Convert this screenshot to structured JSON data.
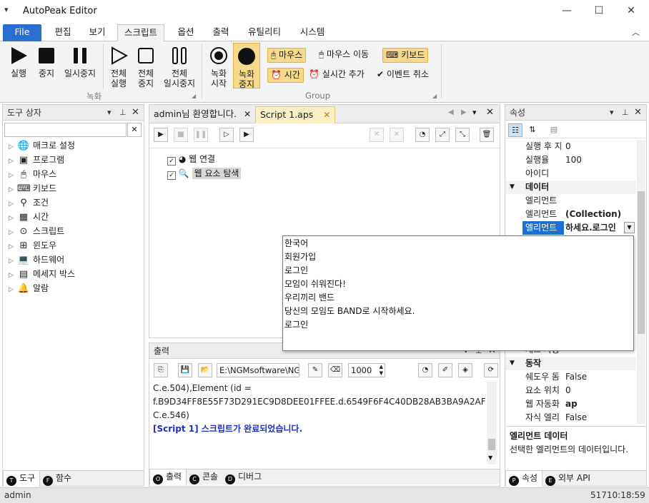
{
  "window": {
    "title": "AutoPeak Editor",
    "qa_icon": "quick-access-chevron",
    "controls": [
      "—",
      "☐",
      "✕"
    ]
  },
  "menu": {
    "file": "File",
    "tabs": [
      "편집",
      "보기",
      "스크립트",
      "옵션",
      "출력",
      "유틸리티",
      "시스템"
    ],
    "active_tab": "스크립트"
  },
  "ribbon": {
    "run": "실행",
    "stop": "중지",
    "pause": "일시중지",
    "run_all_1": "전체",
    "run_all_2": "실행",
    "stop_all_1": "전체",
    "stop_all_2": "중지",
    "pause_all_1": "전체",
    "pause_all_2": "일시중지",
    "group_record": "녹화",
    "rec_start_1": "녹화",
    "rec_start_2": "시작",
    "rec_stop_1": "녹화",
    "rec_stop_2": "중지",
    "mouse": "마우스",
    "mouse_move": "마우스 이동",
    "keyboard": "키보드",
    "time": "시간",
    "realtime_add": "실시간 추가",
    "event_cancel": "이벤트 취소",
    "group_group": "Group",
    "accent": "#f7d98b"
  },
  "toolbox": {
    "title": "도구 상자",
    "search_placeholder": "",
    "items": [
      {
        "label": "매크로 설정",
        "icon": "globe-icon"
      },
      {
        "label": "프로그램",
        "icon": "program-icon"
      },
      {
        "label": "마우스",
        "icon": "mouse-icon"
      },
      {
        "label": "키보드",
        "icon": "keyboard-icon"
      },
      {
        "label": "조건",
        "icon": "condition-icon"
      },
      {
        "label": "시간",
        "icon": "calendar-icon"
      },
      {
        "label": "스크립트",
        "icon": "script-icon"
      },
      {
        "label": "윈도우",
        "icon": "windows-icon"
      },
      {
        "label": "하드웨어",
        "icon": "laptop-icon"
      },
      {
        "label": "메세지 박스",
        "icon": "message-icon"
      },
      {
        "label": "알람",
        "icon": "bell-icon"
      }
    ],
    "bottom_tabs": [
      {
        "key": "T",
        "label": "도구"
      },
      {
        "key": "F",
        "label": "함수"
      }
    ]
  },
  "document": {
    "tabs": [
      {
        "label": "admin님 환영합니다."
      },
      {
        "label": "Script 1.aps"
      }
    ],
    "tree": [
      {
        "label": "웹 연결"
      },
      {
        "label": "웹 요소 탐색"
      }
    ]
  },
  "output": {
    "title": "출력",
    "path": "E:\\NGMsoftware\\NG",
    "count": "1000",
    "lines": [
      "C.e.504),Element (id =",
      "f.B9D34FF8E55F73D291EC9D8DEE01FFEE.d.6549F6F4C40DB28AB3BA9A2AF074245",
      "C.e.546)",
      "",
      "[Script 1] 스크립트가 완료되었습니다."
    ],
    "bottom_tabs": [
      {
        "key": "O",
        "label": "출력"
      },
      {
        "key": "C",
        "label": "콘솔"
      },
      {
        "key": "D",
        "label": "디버그"
      }
    ]
  },
  "properties": {
    "title": "속성",
    "rows": [
      {
        "name": "실행 후 지",
        "value": "0"
      },
      {
        "name": "실행율",
        "value": "100"
      },
      {
        "name": "아이디",
        "value": ""
      }
    ],
    "cat_data": "데이터",
    "data_rows": [
      {
        "name": "엘리먼트",
        "value": ""
      },
      {
        "name": "엘리먼트",
        "value": "(Collection)"
      },
      {
        "name": "엘리먼트",
        "value": "하세요.로그인"
      }
    ],
    "hidden_row": "체크 사용",
    "cat_action": "동작",
    "action_rows": [
      {
        "name": "쉐도우 돔",
        "value": "False"
      },
      {
        "name": "요소 위치",
        "value": "0"
      },
      {
        "name": "웹 자동화",
        "value": "ap"
      },
      {
        "name": "자식 엘리",
        "value": "False"
      }
    ],
    "desc_title": "엘리먼트 데이터",
    "desc_text": "선택한 엘리먼트의 데이터입니다.",
    "bottom_tabs": [
      {
        "key": "P",
        "label": "속성"
      },
      {
        "key": "E",
        "label": "외부 API"
      }
    ]
  },
  "dropdown": {
    "items": [
      "한국어",
      "회원가입",
      "로그인",
      "모임이 쉬워진다!",
      "우리끼리 밴드",
      "당신의 모임도 BAND로 시작하세요.",
      "로그인"
    ]
  },
  "status": {
    "user": "admin",
    "clock": "51710:18:59"
  }
}
